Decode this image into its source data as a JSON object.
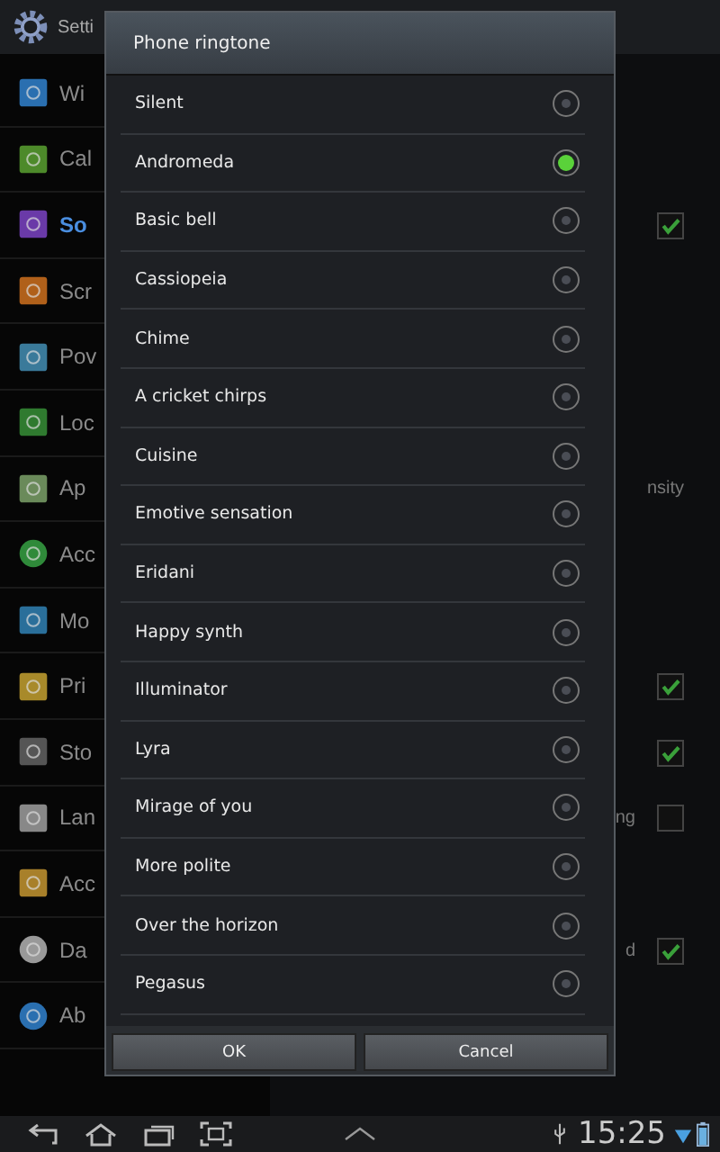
{
  "settings": {
    "title": "Setti",
    "sidebar": [
      {
        "label": "Wi",
        "selected": false
      },
      {
        "label": "Cal",
        "selected": false
      },
      {
        "label": "So",
        "selected": true
      },
      {
        "label": "Scr",
        "selected": false
      },
      {
        "label": "Pov",
        "selected": false
      },
      {
        "label": "Loc",
        "selected": false
      },
      {
        "label": "Ap",
        "selected": false
      },
      {
        "label": "Acc",
        "selected": false
      },
      {
        "label": "Mo",
        "selected": false
      },
      {
        "label": "Pri",
        "selected": false
      },
      {
        "label": "Sto",
        "selected": false
      },
      {
        "label": "Lan",
        "selected": false
      },
      {
        "label": "Acc",
        "selected": false
      },
      {
        "label": "Da",
        "selected": false
      },
      {
        "label": "Ab",
        "selected": false
      }
    ],
    "panel": [
      {
        "kind": "checkbox",
        "checked": true
      },
      {
        "kind": "text",
        "text": "nsity"
      },
      {
        "kind": "checkbox",
        "checked": true
      },
      {
        "kind": "checkbox",
        "checked": true
      },
      {
        "kind": "labeled",
        "text": "ng",
        "checked": false
      },
      {
        "kind": "labeled",
        "text": "d",
        "checked": true
      }
    ]
  },
  "dialog": {
    "title": "Phone ringtone",
    "options": [
      {
        "label": "Silent",
        "selected": false
      },
      {
        "label": "Andromeda",
        "selected": true
      },
      {
        "label": "Basic bell",
        "selected": false
      },
      {
        "label": "Cassiopeia",
        "selected": false
      },
      {
        "label": "Chime",
        "selected": false
      },
      {
        "label": "A cricket chirps",
        "selected": false
      },
      {
        "label": "Cuisine",
        "selected": false
      },
      {
        "label": "Emotive sensation",
        "selected": false
      },
      {
        "label": "Eridani",
        "selected": false
      },
      {
        "label": "Happy synth",
        "selected": false
      },
      {
        "label": "Illuminator",
        "selected": false
      },
      {
        "label": "Lyra",
        "selected": false
      },
      {
        "label": "Mirage of you",
        "selected": false
      },
      {
        "label": "More polite",
        "selected": false
      },
      {
        "label": "Over the horizon",
        "selected": false
      },
      {
        "label": "Pegasus",
        "selected": false
      }
    ],
    "buttons": [
      "OK",
      "Cancel"
    ]
  },
  "status_bar": {
    "time": "15:25"
  }
}
